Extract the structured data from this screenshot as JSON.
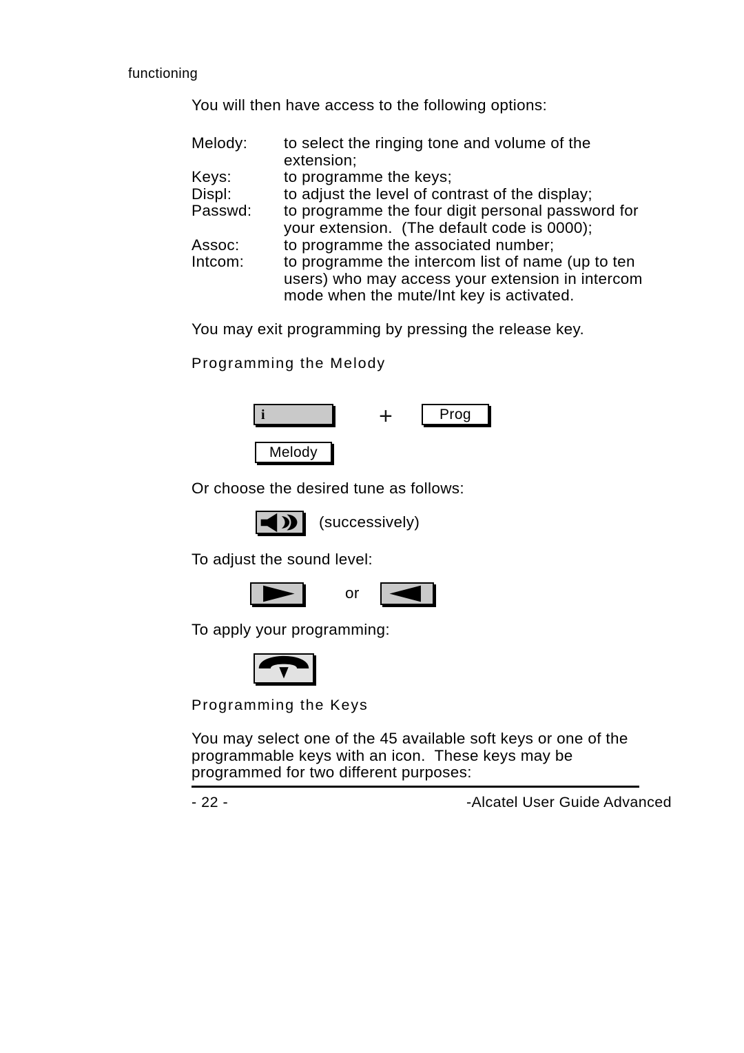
{
  "document": {
    "running_head": "functioning",
    "intro_paragraph": "You will then have access to the following options:",
    "options": [
      {
        "term": "Melody:",
        "definition": "to select the ringing tone and volume of the\nextension;"
      },
      {
        "term": "Keys:",
        "definition": "to programme the keys;"
      },
      {
        "term": "Displ:",
        "definition": "to adjust the level of contrast of the display;"
      },
      {
        "term": "Passwd:",
        "definition": "to programme the four digit personal password for\nyour extension.  (The default code is 0000);"
      },
      {
        "term": "Assoc:",
        "definition": "to programme the associated number;"
      },
      {
        "term": "Intcom:",
        "definition": "to programme the intercom list of name (up to ten\nusers) who may access your extension in intercom\nmode when the mute/Int key is activated."
      }
    ],
    "exit_paragraph": "You may exit programming by pressing the release key.",
    "section_melody": {
      "heading": "Programming the Melody",
      "key_info_label": "i",
      "plus_symbol": "+",
      "key_prog_label": "Prog",
      "key_melody_label": "Melody",
      "choose_paragraph": "Or choose the desired tune as follows:",
      "successively_note": "(successively)",
      "sound_level_paragraph": "To adjust the sound level:",
      "or_note": "or",
      "apply_paragraph": "To apply your programming:"
    },
    "section_keys": {
      "heading": "Programming the Keys",
      "body": "You may select one of the 45 available soft keys or one of the\nprogrammable keys with an icon.  These keys may be\nprogrammed for two different purposes:"
    },
    "footer": {
      "page_number": "- 22 -",
      "guide_title": "-Alcatel User Guide Advanced"
    },
    "colors": {
      "text": "#000000",
      "key_fill_grey": "#c9c9c9",
      "key_fill_light": "#e2e2e2",
      "key_fill_white": "#ffffff",
      "key_border": "#000000",
      "page_background": "#ffffff"
    }
  }
}
